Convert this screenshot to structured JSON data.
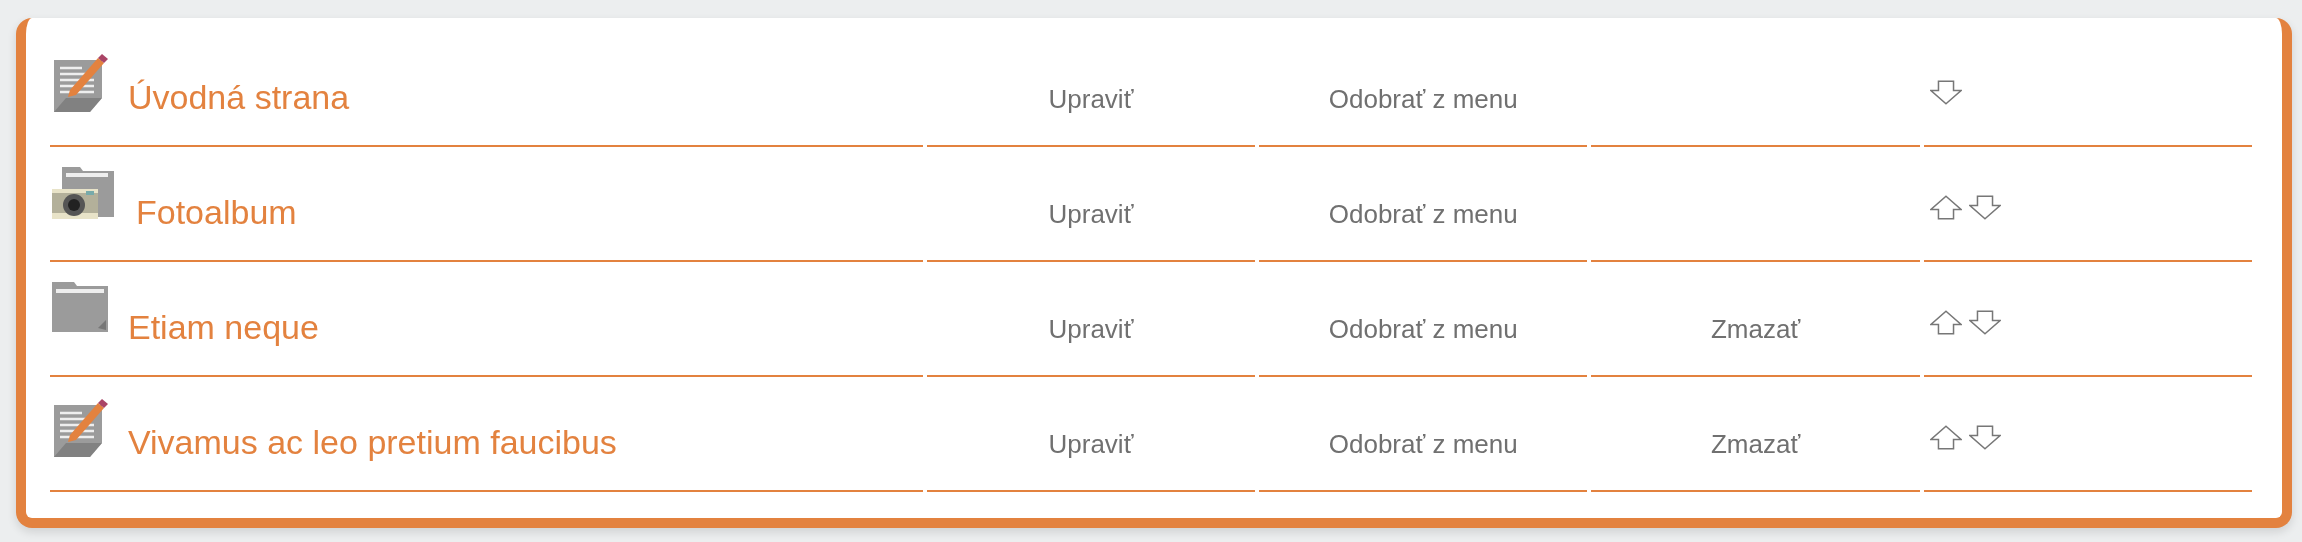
{
  "rows": [
    {
      "kind": "page",
      "title": "Úvodná strana",
      "edit": "Upraviť",
      "remove": "Odobrať z menu",
      "move_up": false,
      "move_down": true
    },
    {
      "kind": "album",
      "title": "Fotoalbum",
      "edit": "Upraviť",
      "remove": "Odobrať z menu",
      "move_up": true,
      "move_down": true
    },
    {
      "kind": "folder",
      "title": "Etiam neque",
      "edit": "Upraviť",
      "remove": "Odobrať z menu",
      "delete": "Zmazať",
      "move_up": true,
      "move_down": true
    },
    {
      "kind": "page",
      "title": "Vivamus ac leo pretium faucibus",
      "edit": "Upraviť",
      "remove": "Odobrať z menu",
      "delete": "Zmazať",
      "move_up": true,
      "move_down": true
    }
  ]
}
